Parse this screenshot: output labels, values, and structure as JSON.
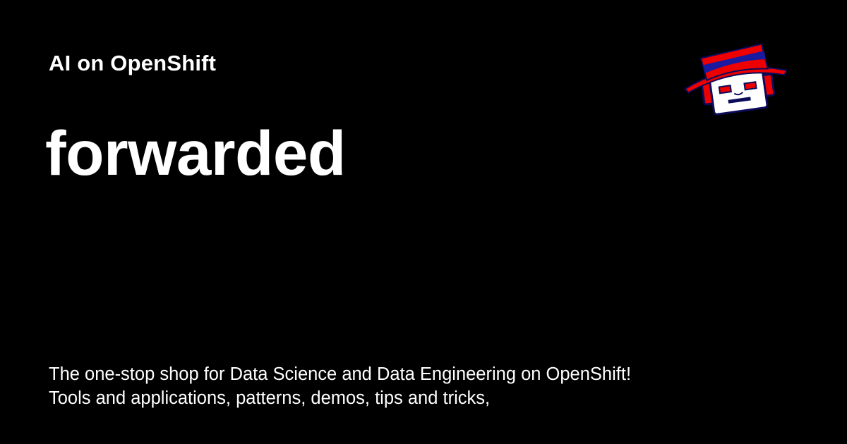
{
  "site": {
    "name": "AI on OpenShift"
  },
  "page": {
    "title": "forwarded",
    "description": "The one-stop shop for Data Science and Data Engineering on OpenShift! Tools and applications, patterns, demos, tips and tricks,"
  },
  "logo": {
    "icon": "robot-with-red-hat-icon",
    "colors": {
      "hat": "#ee0000",
      "hat_band": "#1a1aa0",
      "face": "#ffffff",
      "ears": "#ee0000",
      "eyes": "#ee0000",
      "outline": "#0b0b5a"
    }
  },
  "colors": {
    "background": "#000000",
    "text": "#ffffff"
  }
}
